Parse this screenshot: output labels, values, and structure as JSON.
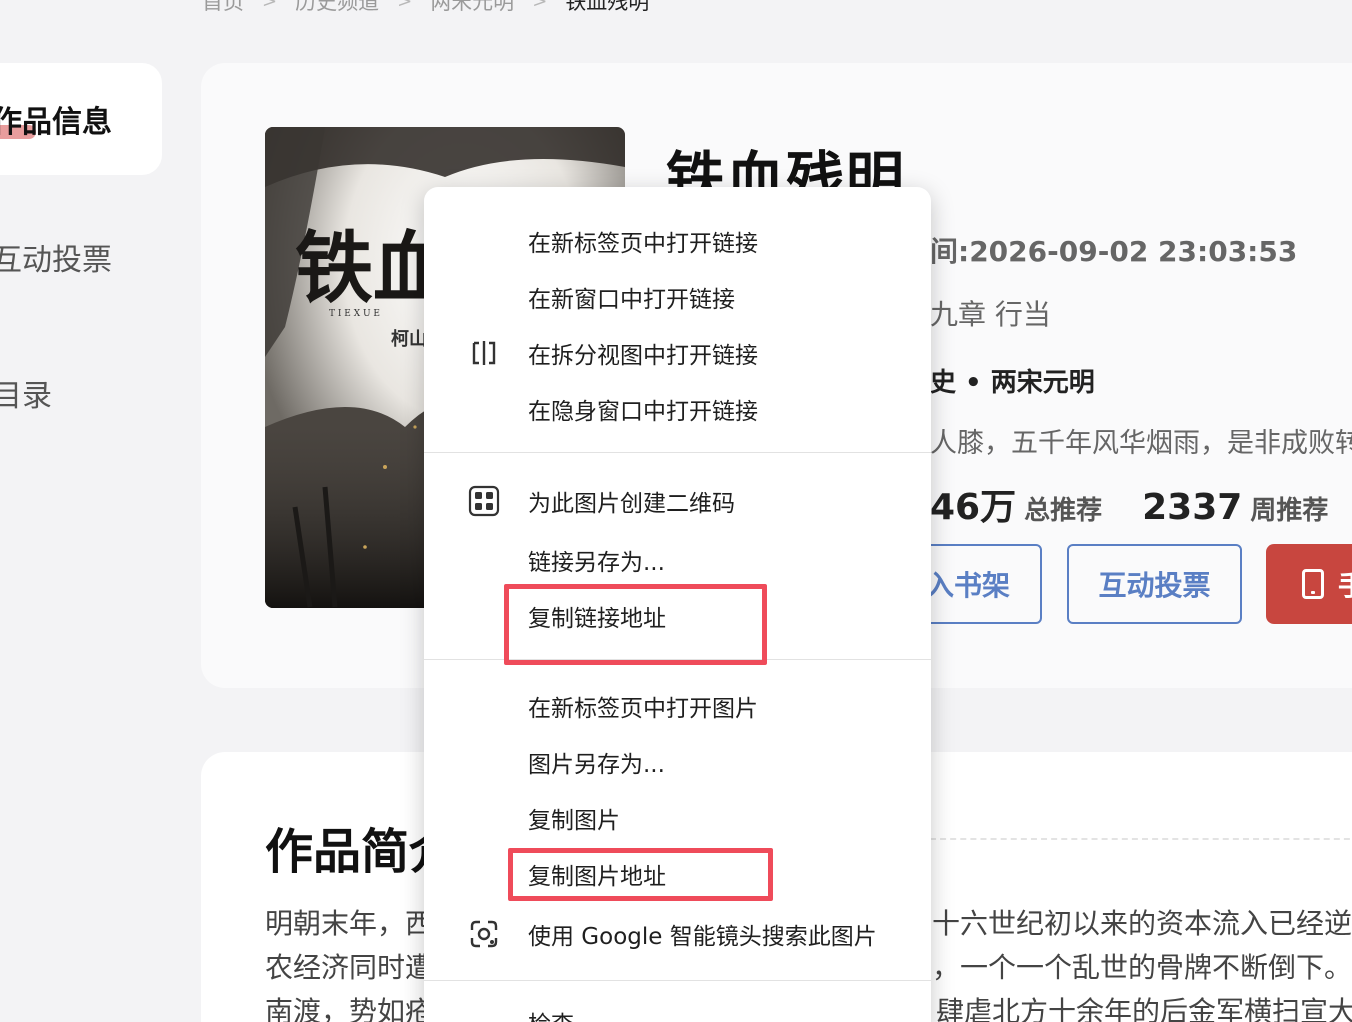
{
  "breadcrumb": [
    "首页",
    "历史频道",
    "两宋元明",
    "铁血残明"
  ],
  "sidebar": {
    "items": [
      {
        "label": "作品信息",
        "active": true
      },
      {
        "label": "互动投票",
        "active": false
      },
      {
        "label": "目录",
        "active": false
      }
    ]
  },
  "book": {
    "title": "铁血残明",
    "cover_title": "铁血",
    "cover_pinyin": "T I E X U E",
    "cover_author": "柯山",
    "update_time": "间:2026-09-02 23:03:53",
    "latest_chapter": "九章  行当",
    "category": "史 • 两宋元明",
    "tagline": "人膝，五千年风华烟雨，是非成败转",
    "total_recommend_value": "46万",
    "total_recommend_label": "总推荐",
    "weekly_recommend_value": "2337",
    "weekly_recommend_label": "周推荐",
    "add_shelf_label": "入书架",
    "vote_label": "互动投票",
    "red_button_label": "手"
  },
  "intro": {
    "heading": "作品简介",
    "line1_left": "明朝末年，西",
    "line1_right": "十六世纪初以来的资本流入已经逆转",
    "line2_left": "农经济同时遭",
    "line2_right": "，一个一个乱世的骨牌不断倒下。",
    "line3_left": "南渡，势如疮",
    "line3_right": "肆虐北方十余年的后金军横扫宣大"
  },
  "context_menu": {
    "items": [
      {
        "label": "在新标签页中打开链接",
        "icon": ""
      },
      {
        "label": "在新窗口中打开链接",
        "icon": ""
      },
      {
        "label": "在拆分视图中打开链接",
        "icon": "split-view-icon"
      },
      {
        "label": "在隐身窗口中打开链接",
        "icon": ""
      },
      {
        "label": "为此图片创建二维码",
        "icon": "qr-code-icon"
      },
      {
        "label": "链接另存为...",
        "icon": ""
      },
      {
        "label": "复制链接地址",
        "icon": "",
        "highlighted": true
      },
      {
        "label": "在新标签页中打开图片",
        "icon": ""
      },
      {
        "label": "图片另存为...",
        "icon": ""
      },
      {
        "label": "复制图片",
        "icon": ""
      },
      {
        "label": "复制图片地址",
        "icon": "",
        "highlighted": true
      },
      {
        "label": "使用 Google 智能镜头搜索此图片",
        "icon": "google-lens-icon"
      },
      {
        "label": "检查",
        "icon": ""
      }
    ],
    "highlight_color": "#ef4b5a"
  },
  "colors": {
    "accent_blue": "#5a7fc4",
    "accent_red": "#c8463f"
  }
}
